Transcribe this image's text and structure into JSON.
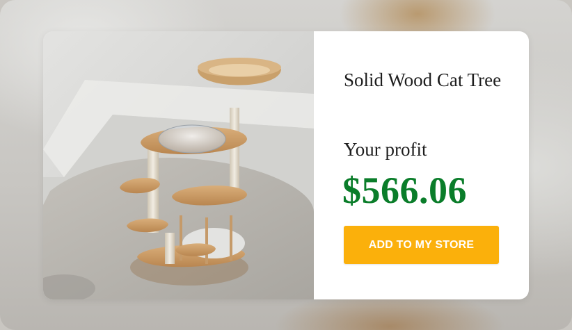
{
  "product": {
    "title": "Solid Wood Cat Tree",
    "image_alt": "Solid wood cat tree product photo",
    "profit_label": "Your profit",
    "profit_value": "$566.06",
    "add_button_label": "ADD TO MY STORE"
  },
  "colors": {
    "price": "#0a7d2a",
    "button": "#fbb00b",
    "button_text": "#ffffff"
  }
}
